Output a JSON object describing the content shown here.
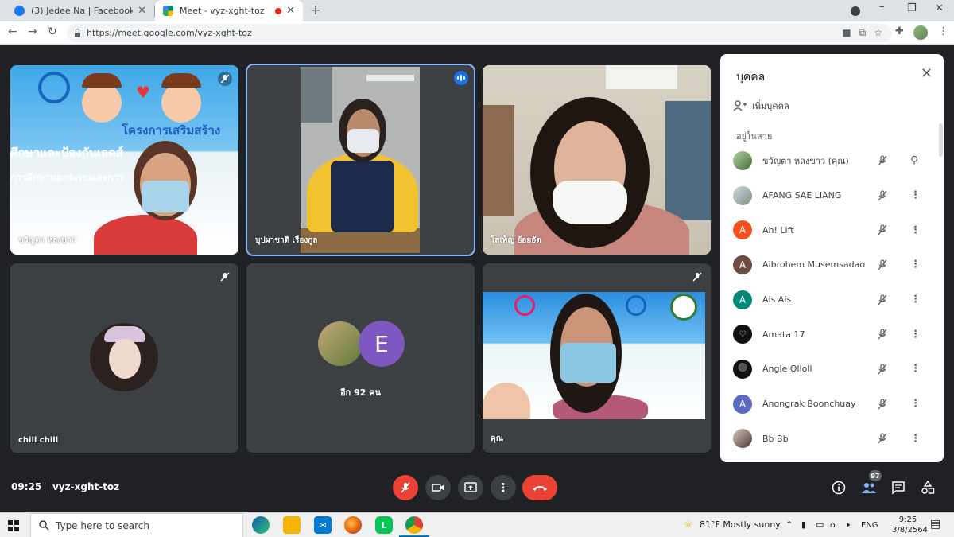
{
  "browser": {
    "tabs": [
      {
        "title": "(3) Jedee Na | Facebook",
        "favicon": "facebook-icon",
        "color": "#1877f2",
        "active": false
      },
      {
        "title": "Meet - vyz-xght-toz",
        "favicon": "google-meet-icon",
        "color": "#00897b",
        "active": true,
        "recording": true
      }
    ],
    "url": "https://meet.google.com/vyz-xght-toz"
  },
  "meet": {
    "time": "09:25",
    "code": "vyz-xght-toz",
    "tiles": [
      {
        "name": "ขวัญตา หลงขาว",
        "banner_text_1": "โครงการเสริมสร้าง",
        "banner_text_2": "ศึกษาและป้องกันเอดส์",
        "banner_text_3": "การศึกษานอกระบบและการ",
        "muted": true
      },
      {
        "name": "บุปผาชาติ เรืองกูล",
        "speaking": true
      },
      {
        "name": "โสเพ็ญ ย้อยอัด"
      },
      {
        "name": "chill chill",
        "muted": true
      },
      {
        "name": "อีก 92 คน",
        "avatar_letter": "E"
      },
      {
        "name": "คุณ",
        "muted": true
      }
    ],
    "participant_count": "97",
    "accent": "#1a73e8",
    "danger": "#ea4335"
  },
  "people_panel": {
    "title": "บุคคล",
    "add_label": "เพิ่มบุคคล",
    "section_label": "อยู่ในสาย",
    "participants": [
      {
        "name": "ขวัญตา หลงขาว (คุณ)",
        "avatar": "photo",
        "color": "#6b8f5e",
        "action": "pin-icon"
      },
      {
        "name": "AFANG SAE LIANG",
        "avatar": "photo",
        "color": "#8aa5b8",
        "action": "more-icon"
      },
      {
        "name": "Ah! Lift",
        "avatar": "A",
        "color": "#f4511e",
        "action": "more-icon"
      },
      {
        "name": "Aibrohem Musemsadao",
        "avatar": "A",
        "color": "#6d4c41",
        "action": "more-icon"
      },
      {
        "name": "Ais Ais",
        "avatar": "A",
        "color": "#00897b",
        "action": "more-icon"
      },
      {
        "name": "Amata 17",
        "avatar": "photo",
        "color": "#111111",
        "action": "more-icon"
      },
      {
        "name": "Angle Olloll",
        "avatar": "photo",
        "color": "#222222",
        "action": "more-icon"
      },
      {
        "name": "Anongrak Boonchuay",
        "avatar": "A",
        "color": "#5c6bc0",
        "action": "more-icon"
      },
      {
        "name": "Bb Bb",
        "avatar": "photo",
        "color": "#9e8a84",
        "action": "more-icon"
      }
    ]
  },
  "taskbar": {
    "search_placeholder": "Type here to search",
    "weather": "81°F  Mostly sunny",
    "language": "ENG",
    "time": "9:25",
    "date": "3/8/2564"
  }
}
